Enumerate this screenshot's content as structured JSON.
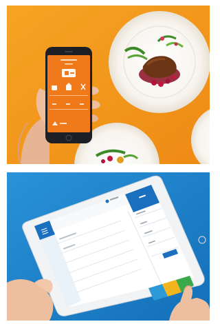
{
  "colors": {
    "orange_background": "#f39a1e",
    "blue_background": "#1c84cf",
    "phone_screen": "#f07a1a",
    "tablet_header": "#1a6fbf"
  },
  "photos": [
    {
      "name": "phone-food-ordering-photo"
    },
    {
      "name": "tablet-pos-photo"
    }
  ]
}
